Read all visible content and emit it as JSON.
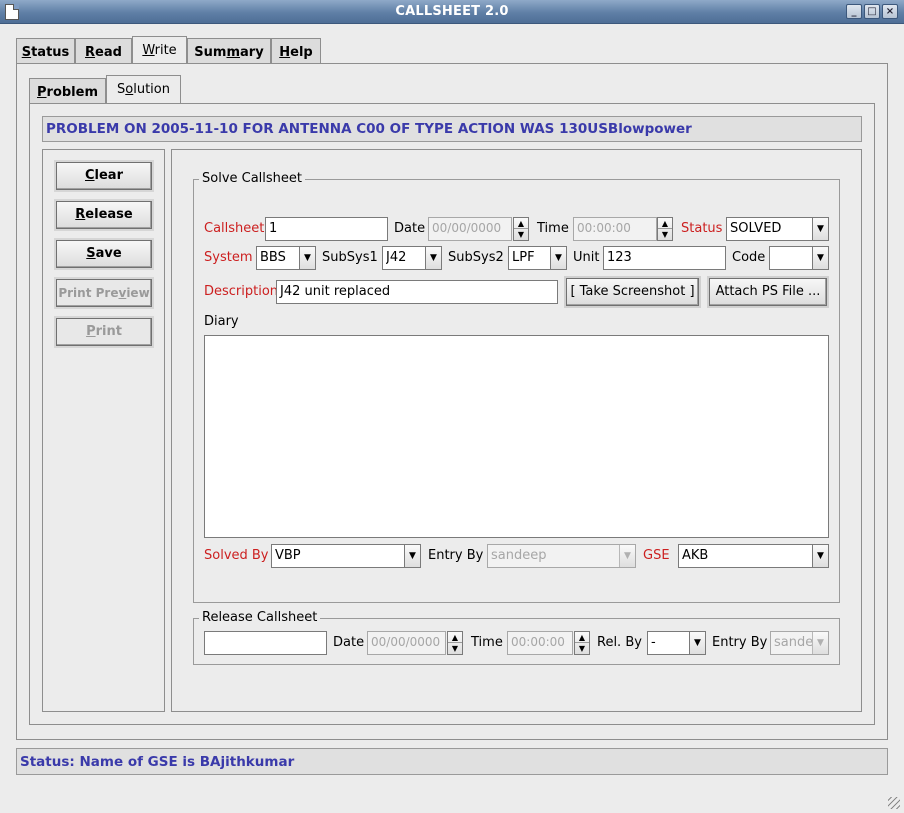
{
  "window": {
    "title": "CALLSHEET 2.0",
    "controls": [
      "minimize-icon",
      "maximize-icon",
      "close-icon"
    ]
  },
  "main_tabs": [
    {
      "label": "Status",
      "underline": "S",
      "rest": "tatus"
    },
    {
      "label": "Read",
      "underline": "R",
      "rest": "ead"
    },
    {
      "label": "Write",
      "underline": "W",
      "rest": "rite",
      "active": true
    },
    {
      "label": "Summary",
      "pre": "Sum",
      "underline": "m",
      "rest": "ary"
    },
    {
      "label": "Help",
      "underline": "H",
      "rest": "elp"
    }
  ],
  "sub_tabs": [
    {
      "label": "Problem",
      "underline": "P",
      "rest": "roblem"
    },
    {
      "label": "Solution",
      "pre": "S",
      "underline": "o",
      "rest": "lution",
      "active": true
    }
  ],
  "problem_banner": "PROBLEM ON 2005-11-10 FOR ANTENNA C00 OF TYPE ACTION WAS 130USBlowpower",
  "actions": [
    {
      "label": "Clear",
      "underline": "C",
      "rest": "lear",
      "enabled": true
    },
    {
      "label": "Release",
      "underline": "R",
      "rest": "elease",
      "enabled": true
    },
    {
      "label": "Save",
      "underline": "S",
      "rest": "ave",
      "enabled": true
    },
    {
      "label": "Print Preview",
      "pre": "Print Pre",
      "underline": "v",
      "rest": "iew",
      "enabled": false
    },
    {
      "label": "Print",
      "underline": "P",
      "rest": "rint",
      "enabled": false
    }
  ],
  "solve": {
    "group_title": "Solve Callsheet",
    "callsheet_label": "Callsheet",
    "callsheet_value": "1",
    "date_label": "Date",
    "date_value": "00/00/0000",
    "time_label": "Time",
    "time_value": "00:00:00",
    "status_label": "Status",
    "status_value": "SOLVED",
    "system_label": "System",
    "system_value": "BBS",
    "subsys1_label": "SubSys1",
    "subsys1_value": "J42",
    "subsys2_label": "SubSys2",
    "subsys2_value": "LPF",
    "unit_label": "Unit",
    "unit_value": "123",
    "code_label": "Code",
    "code_value": "",
    "description_label": "Description",
    "description_value": "J42 unit replaced",
    "screenshot_button": "[ Take Screenshot ]",
    "attach_button": "Attach PS File ...",
    "diary_label": "Diary",
    "diary_value": "",
    "solved_by_label": "Solved By",
    "solved_by_value": "VBP",
    "entry_by_label": "Entry By",
    "entry_by_value": "sandeep",
    "gse_label": "GSE",
    "gse_value": "AKB"
  },
  "release": {
    "group_title": "Release Callsheet",
    "callsheet_value": "",
    "date_label": "Date",
    "date_value": "00/00/0000",
    "time_label": "Time",
    "time_value": "00:00:00",
    "rel_by_label": "Rel. By",
    "rel_by_value": "-",
    "entry_by_label": "Entry By",
    "entry_by_value": "sandeep"
  },
  "status_bar": "Status: Name of GSE is BAjithkumar",
  "colors": {
    "titlebar": "#5f7fa6",
    "banner_text": "#3a3aaa",
    "required_label": "#cc1f1f",
    "background": "#ececec"
  }
}
